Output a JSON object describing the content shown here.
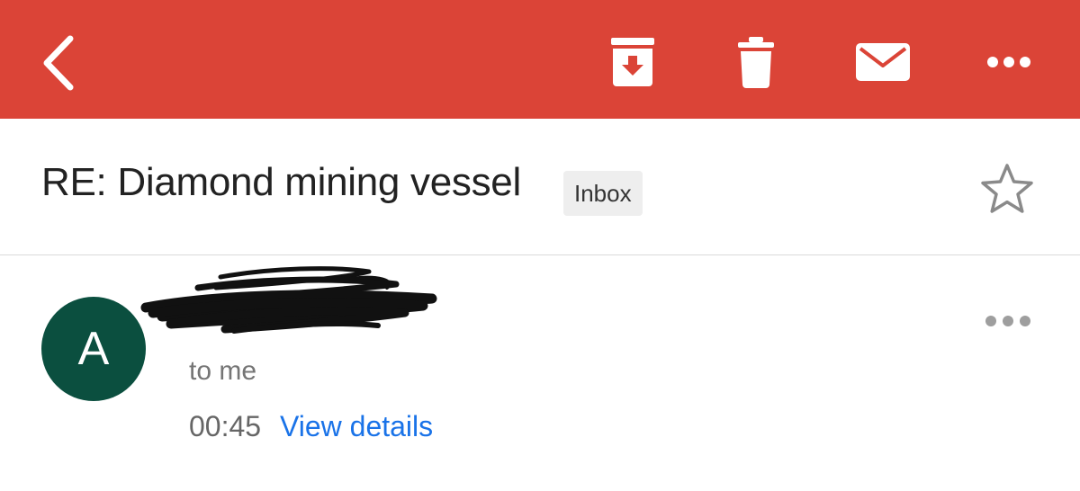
{
  "toolbar": {
    "color": "#db4437",
    "back_icon": "chevron-left-icon",
    "archive_icon": "archive-icon",
    "delete_icon": "trash-icon",
    "mark_unread_icon": "mail-icon",
    "more_icon": "more-horizontal-icon"
  },
  "thread": {
    "subject": "RE: Diamond mining vessel",
    "label": "Inbox",
    "star_icon": "star-outline-icon"
  },
  "message": {
    "avatar_letter": "A",
    "avatar_color": "#0b4f3f",
    "recipient": "to me",
    "time": "00:45",
    "details_link": "View details",
    "more_icon": "more-horizontal-icon"
  }
}
